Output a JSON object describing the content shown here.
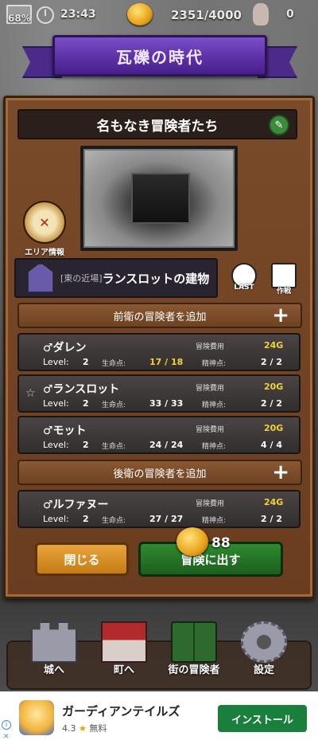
{
  "status": {
    "battery": "68%",
    "time": "23:43",
    "gold": "2351/4000",
    "rabbit_count": "0"
  },
  "title": "瓦礫の時代",
  "party": {
    "name": "名もなき冒険者たち",
    "area_info_label": "エリア情報",
    "location_prefix": "[東の近場]",
    "location_name": "ランスロットの建物",
    "last_label": "LAST",
    "tactics_label": "作戦"
  },
  "labels": {
    "add_front": "前衛の冒険者を追加",
    "add_back": "後衛の冒険者を追加",
    "plus": "+",
    "cost": "冒険費用",
    "level": "Level:",
    "hp": "生命点:",
    "mp": "精神点:"
  },
  "front_adventurers": [
    {
      "name": "♂ダレン",
      "cost": "24G",
      "level": "2",
      "hp": "17 / 18",
      "mp": "2 / 2",
      "starred": false
    },
    {
      "name": "♂ランスロット",
      "cost": "20G",
      "level": "2",
      "hp": "33 / 33",
      "mp": "2 / 2",
      "starred": true
    },
    {
      "name": "♂モット",
      "cost": "20G",
      "level": "2",
      "hp": "24 / 24",
      "mp": "4 / 4",
      "starred": false
    }
  ],
  "back_adventurers": [
    {
      "name": "♂ルファヌー",
      "cost": "24G",
      "level": "2",
      "hp": "27 / 27",
      "mp": "2 / 2",
      "starred": false
    }
  ],
  "actions": {
    "close": "閉じる",
    "go": "冒険に出す",
    "go_cost": "88"
  },
  "nav": [
    {
      "label": "城へ",
      "icon": "castle-icon"
    },
    {
      "label": "町へ",
      "icon": "town-icon"
    },
    {
      "label": "街の冒険者",
      "icon": "book-icon"
    },
    {
      "label": "設定",
      "icon": "gear-icon"
    }
  ],
  "ad": {
    "title": "ガーディアンテイルズ",
    "rating": "4.3",
    "price": "無料",
    "install": "インストール"
  }
}
